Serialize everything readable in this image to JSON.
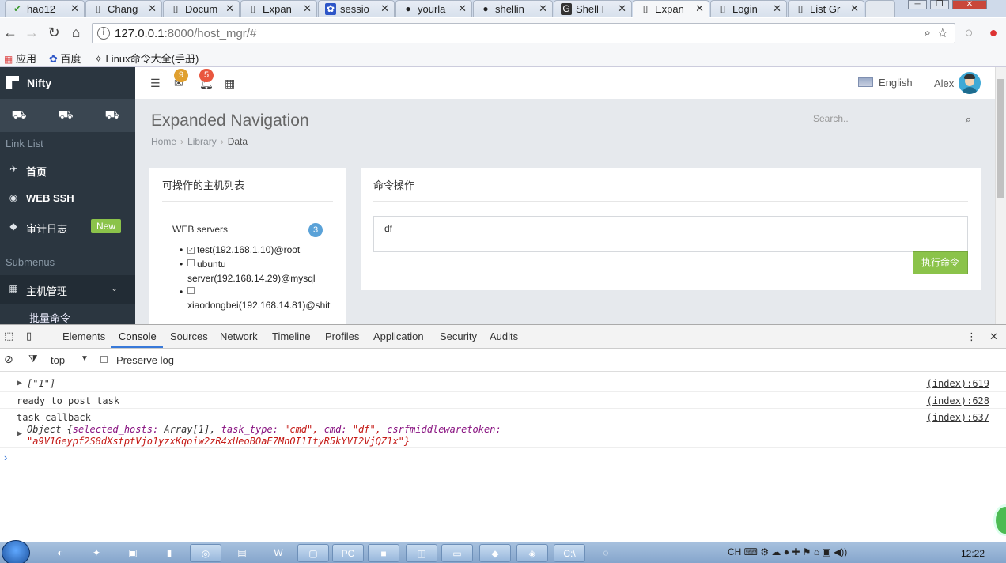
{
  "browser": {
    "tabs": [
      {
        "label": "hao12",
        "icon": "checkmark-icon"
      },
      {
        "label": "Chang",
        "icon": "page-icon"
      },
      {
        "label": "Docum",
        "icon": "page-icon"
      },
      {
        "label": "Expan",
        "icon": "page-icon"
      },
      {
        "label": "sessio",
        "icon": "paw-icon"
      },
      {
        "label": "yourla",
        "icon": "github-icon"
      },
      {
        "label": "shellin",
        "icon": "github-icon"
      },
      {
        "label": "Shell I",
        "icon": "g-icon"
      },
      {
        "label": "Expan",
        "icon": "page-icon",
        "active": true
      },
      {
        "label": "Login",
        "icon": "page-icon"
      },
      {
        "label": "List Gr",
        "icon": "page-icon"
      }
    ],
    "url_host": "127.0.0.1",
    "url_rest": ":8000/host_mgr/#",
    "bookmarks": [
      "应用",
      "百度",
      "Linux命令大全(手册)"
    ]
  },
  "app": {
    "brand": "Nifty",
    "link_list_label": "Link List",
    "menu": [
      {
        "label": "首页",
        "icon": "plane-icon"
      },
      {
        "label": "WEB SSH",
        "icon": "palette-icon"
      },
      {
        "label": "审计日志",
        "icon": "tag-icon",
        "badge": "New"
      }
    ],
    "submenus_label": "Submenus",
    "host_mgr_label": "主机管理",
    "sub_item": "批量命令",
    "notifications": {
      "mail": "9",
      "bell": "5"
    },
    "language": "English",
    "user": "Alex",
    "page_title": "Expanded Navigation",
    "breadcrumb": [
      "Home",
      "Library",
      "Data"
    ],
    "search_placeholder": "Search..",
    "host_panel": {
      "title": "可操作的主机列表",
      "group": "WEB servers",
      "count": "3",
      "hosts": [
        {
          "line1": "test(192.168.1.10)@root",
          "checked": true
        },
        {
          "line1": "ubuntu",
          "line2": "server(192.168.14.29)@mysql",
          "checked": false
        },
        {
          "line1": "",
          "line2": "xiaodongbei(192.168.14.81)@shit",
          "checked": false
        }
      ]
    },
    "cmd_panel": {
      "title": "命令操作",
      "command": "df",
      "button": "执行命令"
    }
  },
  "devtools": {
    "tabs": [
      "Elements",
      "Console",
      "Sources",
      "Network",
      "Timeline",
      "Profiles",
      "Application",
      "Security",
      "Audits"
    ],
    "context": "top",
    "preserve_log": "Preserve log",
    "logs": [
      {
        "text": "[\"1\"]",
        "source": "(index):619"
      },
      {
        "text": "ready to post task",
        "source": "(index):628"
      },
      {
        "text": "task callback",
        "source": "(index):637"
      }
    ],
    "object_line1_prefix": "Object {",
    "object_k1": "selected_hosts:",
    "object_v1": " Array[1], ",
    "object_k2": "task_type:",
    "object_v2": " \"cmd\", ",
    "object_k3": "cmd:",
    "object_v3": " \"df\", ",
    "object_k4": "csrfmiddlewaretoken:",
    "object_line2": "\"a9V1Geypf2S8dXstptVjo1yzxKqoiw2zR4xUeoBOaE7MnOI1ItyR5kYVI2VjQZ1x\"}"
  },
  "taskbar": {
    "clock": "12:22",
    "tray_text": "CH"
  }
}
